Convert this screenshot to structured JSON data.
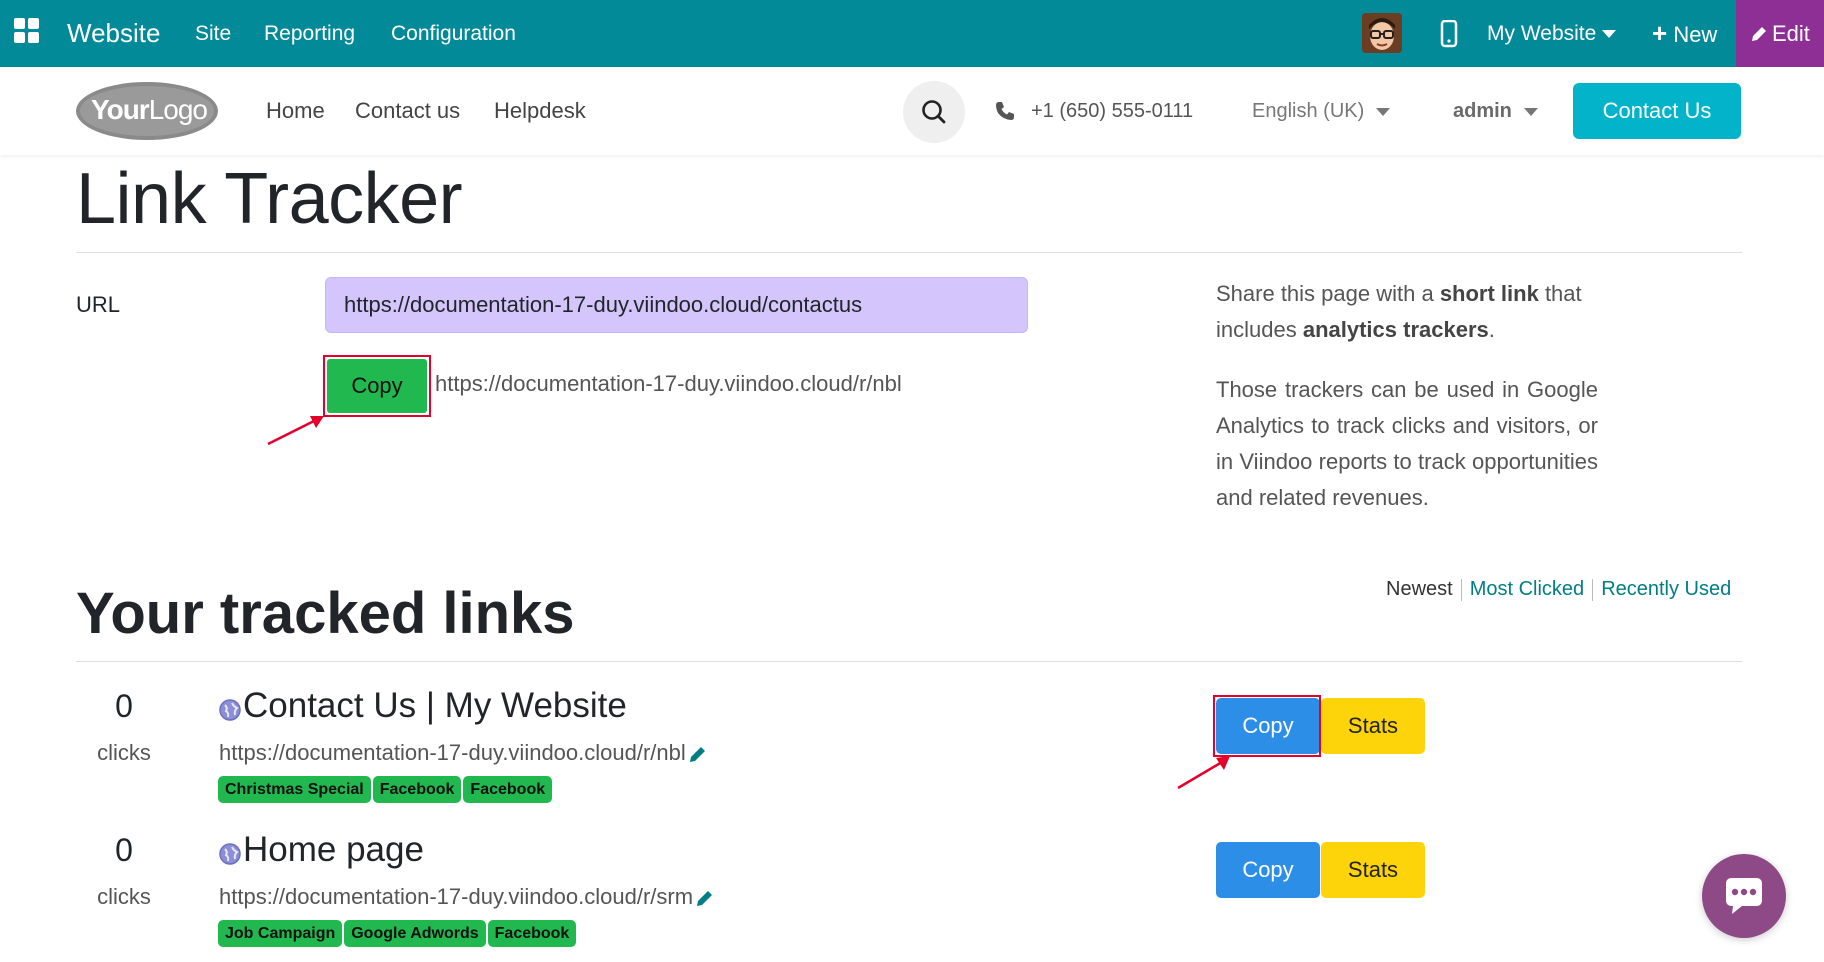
{
  "topbar": {
    "brand": "Website",
    "menus": [
      "Site",
      "Reporting",
      "Configuration"
    ],
    "website_selector": "My Website",
    "new_label": "New",
    "edit_label": "Edit",
    "bar_color": "#028a98",
    "edit_color": "#8d2f95"
  },
  "header": {
    "logo_text_bold": "Your",
    "logo_text_light": "Logo",
    "nav": [
      "Home",
      "Contact us",
      "Helpdesk"
    ],
    "phone": "+1 (650) 555-0111",
    "language": "English (UK)",
    "user": "admin",
    "contact_button": "Contact Us"
  },
  "main": {
    "title": "Link Tracker",
    "url_label": "URL",
    "url_value": "https://documentation-17-duy.viindoo.cloud/contactus",
    "copy_label": "Copy",
    "short_url": "https://documentation-17-duy.viindoo.cloud/r/nbl",
    "side": {
      "p1_a": "Share this page with a ",
      "p1_b": "short link",
      "p1_c": " that includes ",
      "p1_d": "analytics trackers",
      "p1_e": ".",
      "p2": "Those trackers can be used in Google Analytics to track clicks and visitors, or in Viindoo reports to track opportunities and related revenues."
    },
    "sort": {
      "newest": "Newest",
      "most_clicked": "Most Clicked",
      "recently_used": "Recently Used"
    },
    "section_title": "Your tracked links",
    "links": [
      {
        "clicks": "0",
        "clicks_label": "clicks",
        "title": "Contact Us | My Website",
        "url": "https://documentation-17-duy.viindoo.cloud/r/nbl",
        "tags": [
          "Christmas Special",
          "Facebook",
          "Facebook"
        ],
        "copy": "Copy",
        "stats": "Stats"
      },
      {
        "clicks": "0",
        "clicks_label": "clicks",
        "title": "Home page",
        "url": "https://documentation-17-duy.viindoo.cloud/r/srm",
        "tags": [
          "Job Campaign",
          "Google Adwords",
          "Facebook"
        ],
        "copy": "Copy",
        "stats": "Stats"
      }
    ]
  }
}
